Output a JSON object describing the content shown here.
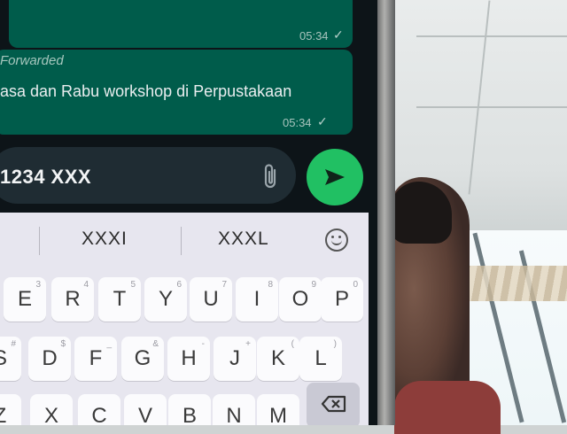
{
  "chat": {
    "top_bubble": {
      "time": "05:34"
    },
    "main_bubble": {
      "label": "Forwarded",
      "text": "asa dan Rabu workshop di Perpustakaan",
      "time": "05:34"
    }
  },
  "composer": {
    "text": "1234 XXX",
    "attach_icon": "paperclip-icon",
    "send_icon": "send-icon",
    "send_color": "#21c063"
  },
  "keyboard": {
    "suggestions": [
      "XXXI",
      "XXXL"
    ],
    "emoji_icon": "emoji-icon",
    "row1": [
      {
        "l": "E",
        "s": "3"
      },
      {
        "l": "R",
        "s": "4"
      },
      {
        "l": "T",
        "s": "5"
      },
      {
        "l": "Y",
        "s": "6"
      },
      {
        "l": "U",
        "s": "7"
      },
      {
        "l": "I",
        "s": "8"
      },
      {
        "l": "O",
        "s": "9"
      },
      {
        "l": "P",
        "s": "0"
      }
    ],
    "row2": [
      {
        "l": "S",
        "s": "#"
      },
      {
        "l": "D",
        "s": "$"
      },
      {
        "l": "F",
        "s": "_"
      },
      {
        "l": "G",
        "s": "&"
      },
      {
        "l": "H",
        "s": "-"
      },
      {
        "l": "J",
        "s": "+"
      },
      {
        "l": "K",
        "s": "("
      },
      {
        "l": "L",
        "s": ")"
      }
    ],
    "row3": [
      {
        "l": "Z",
        "s": ""
      },
      {
        "l": "X",
        "s": ""
      },
      {
        "l": "C",
        "s": ""
      },
      {
        "l": "V",
        "s": ""
      },
      {
        "l": "B",
        "s": ""
      },
      {
        "l": "N",
        "s": ""
      },
      {
        "l": "M",
        "s": ""
      }
    ],
    "backspace_icon": "backspace-icon"
  }
}
